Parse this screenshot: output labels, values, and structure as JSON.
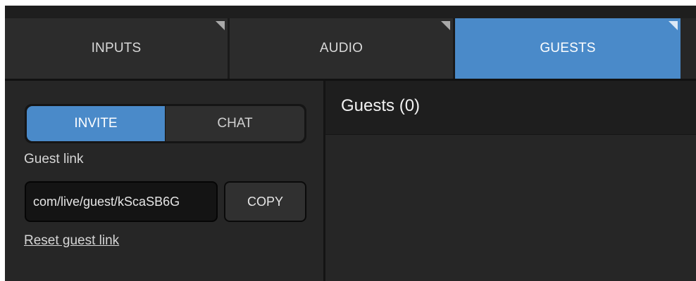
{
  "tabs": [
    {
      "label": "INPUTS",
      "active": false
    },
    {
      "label": "AUDIO",
      "active": false
    },
    {
      "label": "GUESTS",
      "active": true
    }
  ],
  "guests_panel": {
    "segmented": {
      "invite_label": "INVITE",
      "chat_label": "CHAT",
      "selected": "INVITE"
    },
    "guest_link_label": "Guest link",
    "guest_link_value": "com/live/guest/kScaSB6G",
    "copy_label": "COPY",
    "reset_label": "Reset guest link"
  },
  "guests_list": {
    "title": "Guests (0)"
  },
  "colors": {
    "accent": "#4a8ac9",
    "panel_bg": "#262626",
    "header_bg": "#1e1e1e"
  }
}
